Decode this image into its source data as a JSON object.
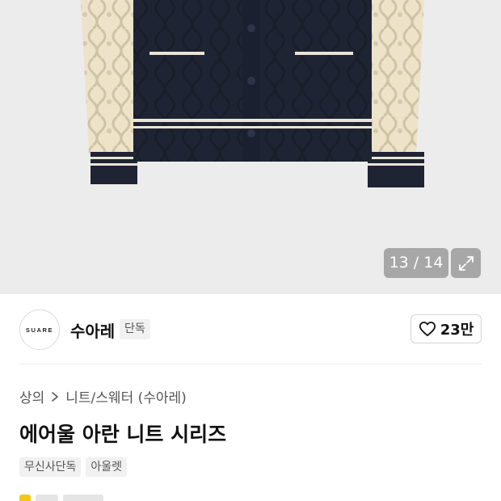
{
  "gallery": {
    "counter": "13 / 14",
    "expand_icon": "expand-icon"
  },
  "brand": {
    "logo_text": "SUARE",
    "name": "수아레",
    "tag": "단독"
  },
  "like": {
    "icon": "heart-icon",
    "count": "23만"
  },
  "breadcrumb": {
    "items": [
      "상의",
      "니트/스웨터 (수아레)"
    ],
    "separator_icon": "chevron-right-icon"
  },
  "product": {
    "title": "에어울 아란 니트 시리즈",
    "chips": [
      "무신사단독",
      "아울렛"
    ]
  },
  "colors": {
    "navy": "#1f2434",
    "cream": "#ece3c9",
    "background": "#ececec"
  }
}
